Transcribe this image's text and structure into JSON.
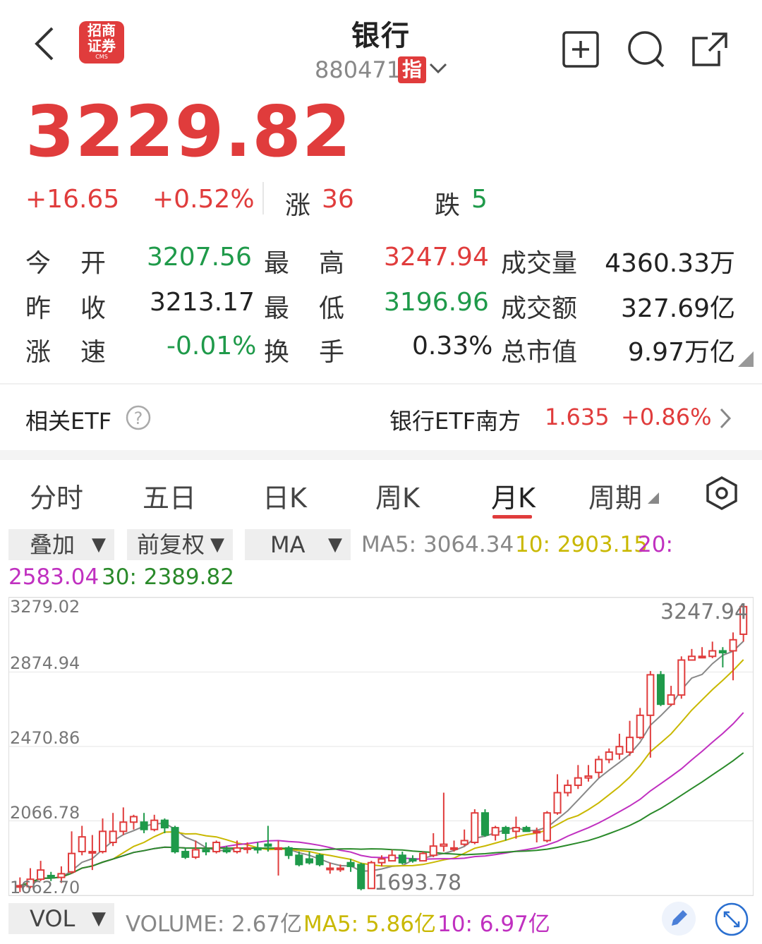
{
  "header": {
    "title": "银行",
    "code": "880471",
    "index_badge": "指",
    "logo_text_1": "招商",
    "logo_text_2": "证券",
    "logo_sub": "CMS"
  },
  "quote": {
    "price": "3229.82",
    "change": "+16.65",
    "change_pct": "+0.52%",
    "up_label": "涨",
    "up_count": "36",
    "down_label": "跌",
    "down_count": "5"
  },
  "stats": {
    "open_label": "今开",
    "open": "3207.56",
    "high_label": "最高",
    "high": "3247.94",
    "volume_label": "成交量",
    "volume": "4360.33万",
    "prev_close_label": "昨收",
    "prev_close": "3213.17",
    "low_label": "最低",
    "low": "3196.96",
    "amount_label": "成交额",
    "amount": "327.69亿",
    "speed_label": "涨速",
    "speed": "-0.01%",
    "turnover_label": "换手",
    "turnover": "0.33%",
    "market_cap_label": "总市值",
    "market_cap": "9.97万亿"
  },
  "etf": {
    "label": "相关ETF",
    "name": "银行ETF南方",
    "price": "1.635",
    "change_pct": "+0.86%"
  },
  "tabs": [
    "分时",
    "五日",
    "日K",
    "周K",
    "月K",
    "周期"
  ],
  "active_tab": "月K",
  "controls": {
    "overlay": "叠加",
    "adjust": "前复权",
    "indicator": "MA",
    "vol": "VOL"
  },
  "ma": {
    "ma5": "MA5: 3064.34",
    "ma10": "10: 2903.15",
    "ma20_a": "20:",
    "ma20_b": "2583.04",
    "ma30": "30: 2389.82"
  },
  "volume_line": {
    "volume": "VOLUME: 2.67亿",
    "ma5": "MA5: 5.86亿",
    "ma10": "10: 6.97亿"
  },
  "colors": {
    "up": "#e03c3c",
    "down": "#1f9a4a",
    "ma5": "#888888",
    "ma10": "#c9b800",
    "ma20": "#c030c0",
    "ma30": "#2a8a2a"
  },
  "chart_data": {
    "type": "candlestick",
    "y_ticks": [
      "3279.02",
      "2874.94",
      "2470.86",
      "2066.78",
      "1662.70"
    ],
    "ylim": [
      1662.7,
      3279.02
    ],
    "high_label": "3247.94",
    "low_label": "1693.78",
    "candles": [
      [
        1710,
        1715,
        1680,
        1760
      ],
      [
        1710,
        1750,
        1700,
        1810
      ],
      [
        1750,
        1800,
        1740,
        1850
      ],
      [
        1770,
        1760,
        1740,
        1790
      ],
      [
        1760,
        1780,
        1730,
        1820
      ],
      [
        1790,
        1890,
        1780,
        2010
      ],
      [
        1900,
        1980,
        1880,
        2040
      ],
      [
        1900,
        1900,
        1800,
        1990
      ],
      [
        1900,
        2010,
        1890,
        2080
      ],
      [
        1950,
        2010,
        1930,
        2110
      ],
      [
        2010,
        2060,
        1990,
        2140
      ],
      [
        2060,
        2090,
        2020,
        2100
      ],
      [
        2060,
        2020,
        2000,
        2110
      ],
      [
        2020,
        2070,
        2010,
        2100
      ],
      [
        2070,
        2030,
        2000,
        2080
      ],
      [
        2030,
        1900,
        1890,
        2040
      ],
      [
        1900,
        1870,
        1860,
        1920
      ],
      [
        1870,
        1910,
        1860,
        1960
      ],
      [
        1910,
        1900,
        1880,
        1950
      ],
      [
        1900,
        1950,
        1890,
        1960
      ],
      [
        1910,
        1900,
        1890,
        1930
      ],
      [
        1900,
        1920,
        1890,
        1960
      ],
      [
        1920,
        1920,
        1890,
        1950
      ],
      [
        1920,
        1910,
        1890,
        1950
      ],
      [
        1940,
        1930,
        1900,
        2040
      ],
      [
        1920,
        1920,
        1770,
        1960
      ],
      [
        1920,
        1880,
        1860,
        1930
      ],
      [
        1880,
        1830,
        1820,
        1900
      ],
      [
        1860,
        1840,
        1830,
        1900
      ],
      [
        1880,
        1830,
        1820,
        1890
      ],
      [
        1810,
        1810,
        1780,
        1840
      ],
      [
        1810,
        1810,
        1790,
        1830
      ],
      [
        1840,
        1820,
        1790,
        1860
      ],
      [
        1830,
        1700,
        1690,
        1840
      ],
      [
        1700,
        1840,
        1700,
        1850
      ],
      [
        1840,
        1860,
        1820,
        1880
      ],
      [
        1850,
        1880,
        1850,
        1910
      ],
      [
        1880,
        1840,
        1830,
        1900
      ],
      [
        1860,
        1850,
        1840,
        1880
      ],
      [
        1850,
        1890,
        1850,
        1900
      ],
      [
        1880,
        1930,
        1870,
        2000
      ],
      [
        1930,
        1940,
        1900,
        2220
      ],
      [
        1920,
        1920,
        1900,
        1960
      ],
      [
        1940,
        1960,
        1930,
        2020
      ],
      [
        1950,
        2110,
        1940,
        2130
      ],
      [
        2110,
        1990,
        1980,
        2130
      ],
      [
        1990,
        2030,
        1960,
        2040
      ],
      [
        2030,
        2000,
        1960,
        2040
      ],
      [
        2010,
        2030,
        1970,
        2090
      ],
      [
        2030,
        2010,
        2010,
        2040
      ],
      [
        2010,
        2010,
        1950,
        2030
      ],
      [
        1960,
        2110,
        1950,
        2120
      ],
      [
        2110,
        2220,
        2100,
        2320
      ],
      [
        2220,
        2260,
        2200,
        2290
      ],
      [
        2260,
        2300,
        2240,
        2370
      ],
      [
        2300,
        2310,
        2280,
        2370
      ],
      [
        2330,
        2400,
        2300,
        2420
      ],
      [
        2400,
        2440,
        2380,
        2460
      ],
      [
        2430,
        2470,
        2400,
        2540
      ],
      [
        2440,
        2520,
        2420,
        2610
      ],
      [
        2520,
        2640,
        2510,
        2680
      ],
      [
        2640,
        2860,
        2410,
        2880
      ],
      [
        2860,
        2700,
        2690,
        2880
      ],
      [
        2700,
        2750,
        2690,
        2800
      ],
      [
        2750,
        2940,
        2730,
        2960
      ],
      [
        2940,
        2960,
        2940,
        3000
      ],
      [
        2960,
        2960,
        2950,
        3010
      ],
      [
        2960,
        2990,
        2950,
        3040
      ],
      [
        2990,
        2980,
        2900,
        3010
      ],
      [
        2990,
        3050,
        2830,
        3090
      ],
      [
        3080,
        3230,
        3040,
        3247.94
      ]
    ],
    "ma_lines": {
      "MA5": "3064.34",
      "MA10": "2903.15",
      "MA20": "2583.04",
      "MA30": "2389.82"
    }
  }
}
